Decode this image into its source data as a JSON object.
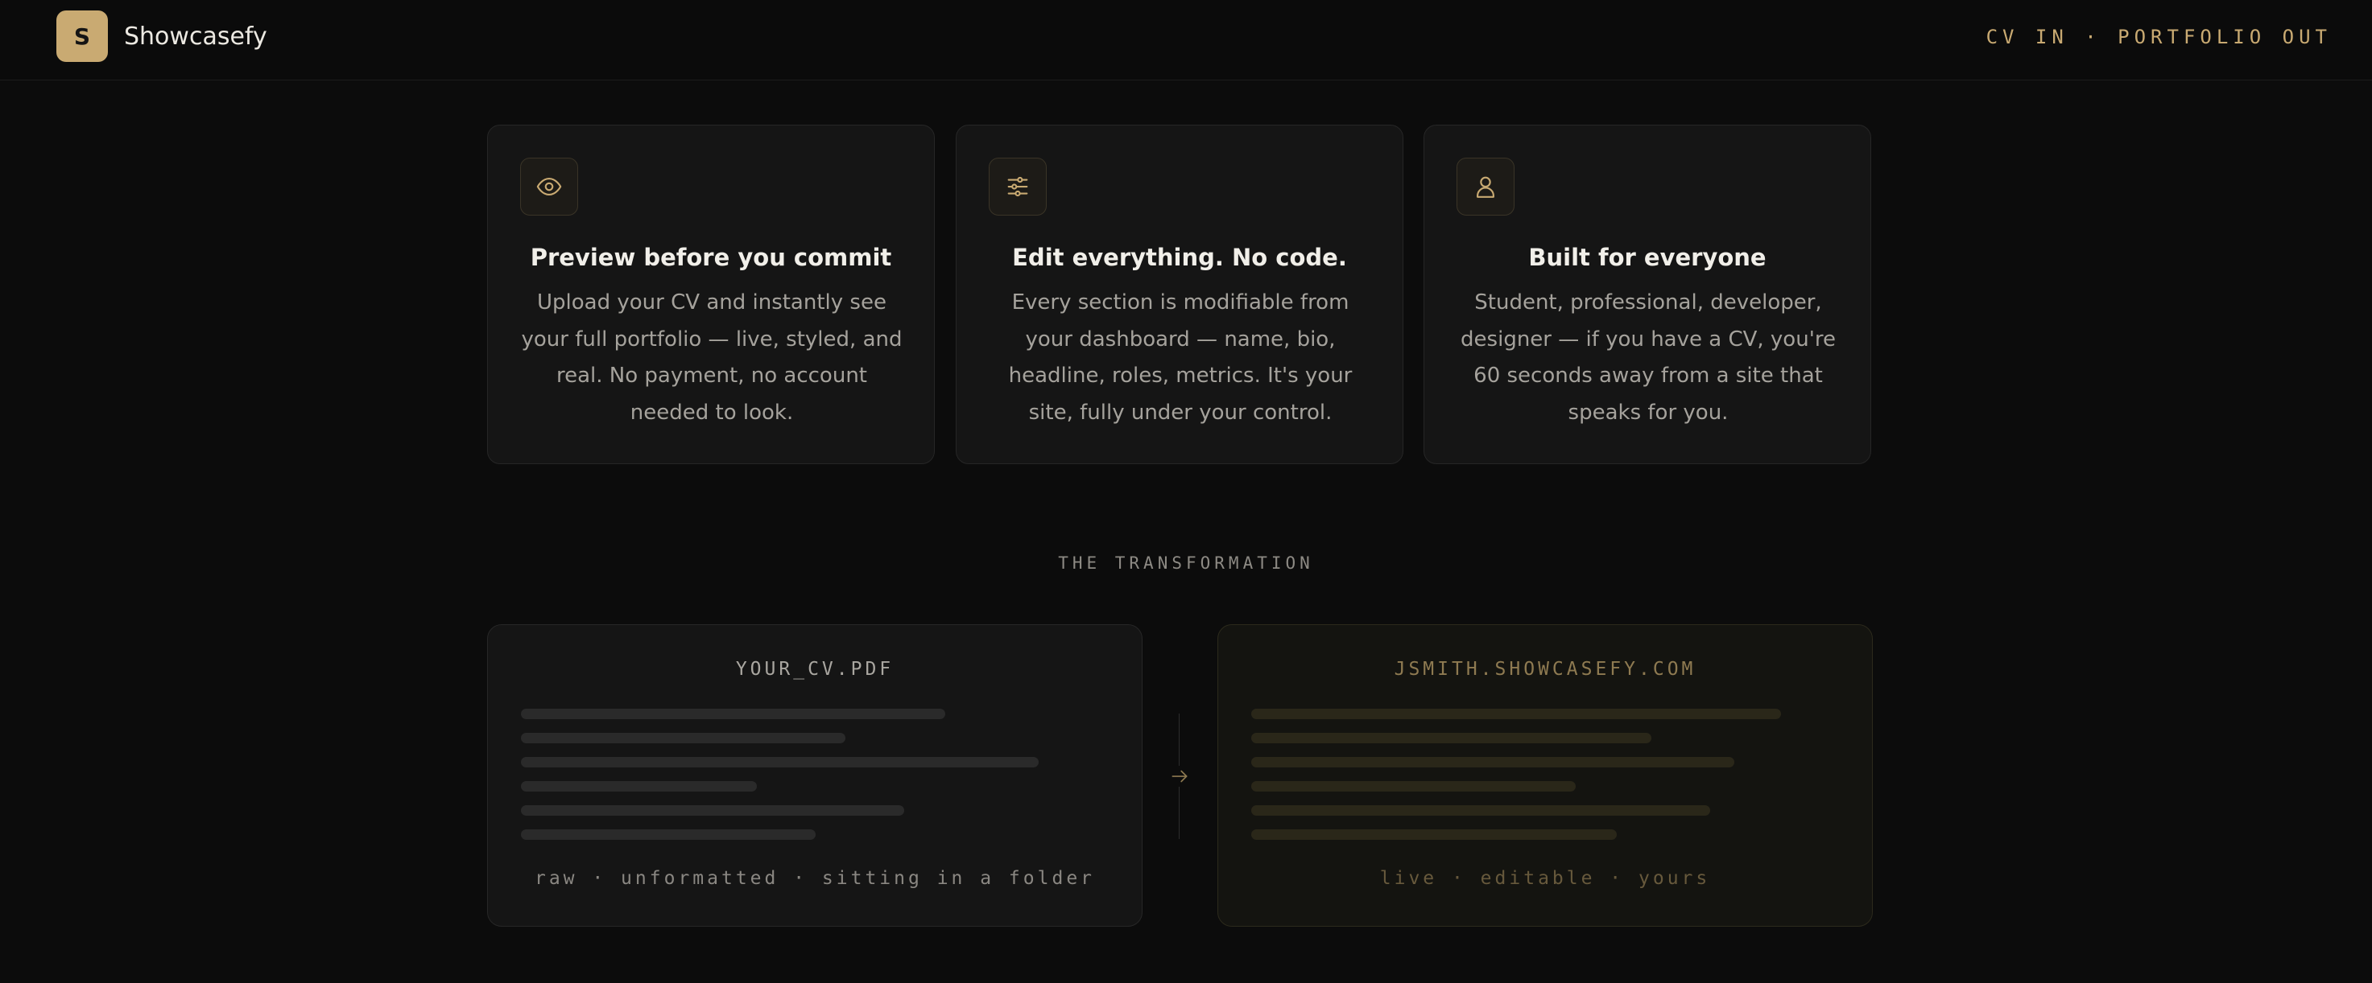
{
  "header": {
    "logo_letter": "S",
    "brand": "Showcasefy",
    "tagline": "CV IN · PORTFOLIO OUT"
  },
  "features": [
    {
      "icon": "eye-icon",
      "title": "Preview before you commit",
      "body": "Upload your CV and instantly see your full portfolio — live, styled, and real. No payment, no account needed to look."
    },
    {
      "icon": "sliders-icon",
      "title": "Edit everything. No code.",
      "body": "Every section is modifiable from your dashboard — name, bio, headline, roles, metrics. It's your site, fully under your control."
    },
    {
      "icon": "user-icon",
      "title": "Built for everyone",
      "body": "Student, professional, developer, designer — if you have a CV, you're 60 seconds away from a site that speaks for you."
    }
  ],
  "transformation": {
    "label": "THE TRANSFORMATION",
    "before": {
      "title": "YOUR_CV.PDF",
      "caption": "raw · unformatted · sitting in a folder"
    },
    "after": {
      "title": "JSMITH.SHOWCASEFY.COM",
      "caption": "live · editable · yours"
    },
    "arrow_icon": "arrow-right-icon"
  },
  "colors": {
    "accent": "#c9aa72",
    "background": "#0c0c0c",
    "card": "#151515"
  }
}
